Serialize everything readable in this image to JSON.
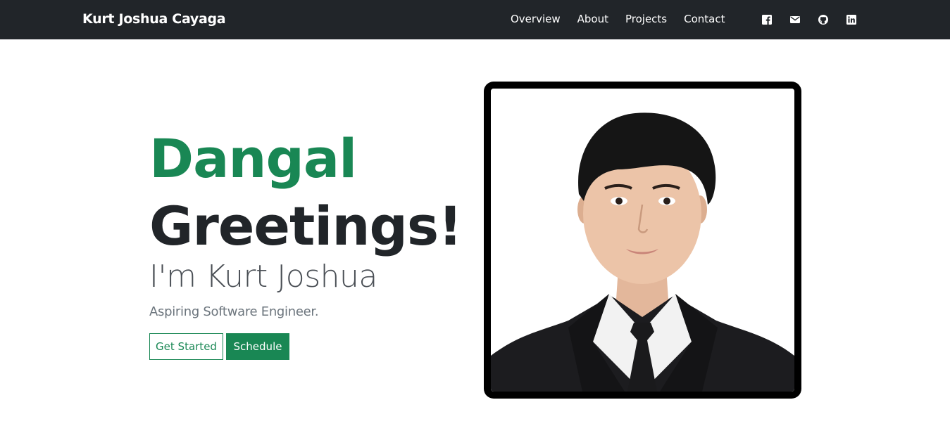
{
  "navbar": {
    "brand": "Kurt Joshua Cayaga",
    "links": [
      "Overview",
      "About",
      "Projects",
      "Contact"
    ],
    "social_icons": [
      "facebook-icon",
      "mail-icon",
      "github-icon",
      "linkedin-icon"
    ]
  },
  "hero": {
    "headline_line1": "Dangal",
    "headline_line2": "Greetings!",
    "intro": "I'm Kurt Joshua",
    "tagline": "Aspiring Software Engineer.",
    "primary_button": "Get Started",
    "secondary_button": "Schedule"
  },
  "colors": {
    "accent": "#198754",
    "navbar_bg": "#212529",
    "text_dark": "#212529",
    "text_muted": "#6c757d"
  }
}
